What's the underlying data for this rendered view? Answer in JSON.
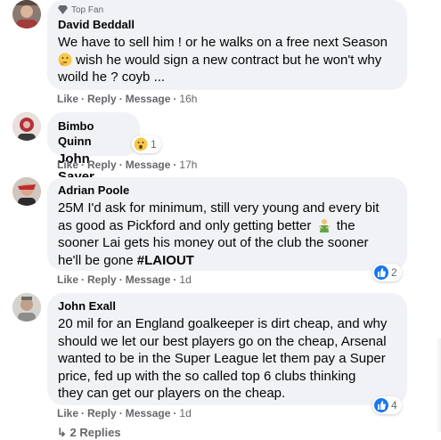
{
  "comments": [
    {
      "badge": "Top Fan",
      "name": "David Beddall",
      "lines": [
        "We have to sell him ! or he walks on a free next Season",
        "wish he would sign a new contract but he won't why",
        "woild he ? coyb ..."
      ],
      "actions": {
        "like": "Like",
        "reply": "Reply",
        "message": "Message",
        "time": "16h"
      }
    },
    {
      "name": "Bimbo Quinn",
      "text": "John Sayer",
      "reaction_count": "1",
      "actions": {
        "like": "Like",
        "reply": "Reply",
        "message": "Message",
        "time": "17h"
      }
    },
    {
      "name": "Adrian Poole",
      "lines": [
        "25M I'd ask for minimum, still very young and every bit",
        "as good as Pickford and only getting better",
        "the",
        "sooner Lai gets his money out of the club the sooner",
        "he'll be gone ",
        "#LAIOUT"
      ],
      "reaction_count": "2",
      "actions": {
        "like": "Like",
        "reply": "Reply",
        "message": "Message",
        "time": "1d"
      }
    },
    {
      "name": "John Exall",
      "lines": [
        "20 mil for an England goalkeeper is dirt cheap, and why",
        "should we let our best players go on the cheap, Arsenal",
        "wanted to be in the Super League let them pay a Super",
        "price, fed up with the so called top 6 clubs thinking",
        "they can get our players on the cheap."
      ],
      "reaction_count": "4",
      "actions": {
        "like": "Like",
        "reply": "Reply",
        "message": "Message",
        "time": "1d"
      }
    }
  ],
  "replies_partial": "↳ 2 Replies",
  "colors": {
    "bubble": "#f0f2f5",
    "meta": "#65676b",
    "like_blue": "#1877f2"
  }
}
